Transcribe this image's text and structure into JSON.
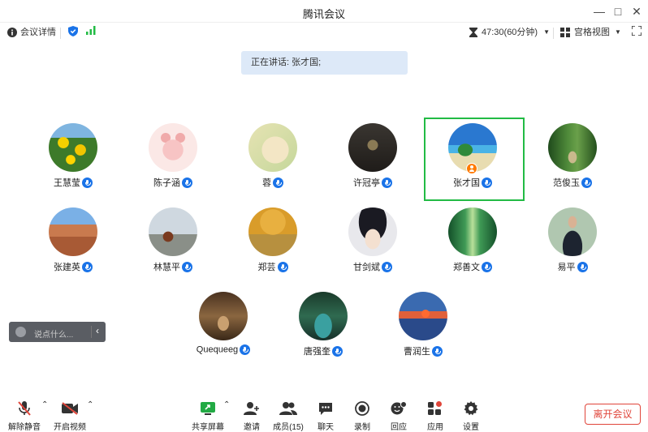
{
  "window": {
    "title": "腾讯会议"
  },
  "infobar": {
    "meeting_details": "会议详情",
    "timer": "47:30(60分钟)",
    "view_mode": "宫格视图"
  },
  "speaking": {
    "text": "正在讲话: 张才国;"
  },
  "participants": [
    {
      "name": "王慧莹"
    },
    {
      "name": "陈子涵"
    },
    {
      "name": "蓉"
    },
    {
      "name": "许冠亭"
    },
    {
      "name": "张才国"
    },
    {
      "name": "范俊玉"
    },
    {
      "name": "张建英"
    },
    {
      "name": "林慧平"
    },
    {
      "name": "郑芸"
    },
    {
      "name": "甘剑斌"
    },
    {
      "name": "郑善文"
    },
    {
      "name": "易平"
    },
    {
      "name": "Quequeeg"
    },
    {
      "name": "唐强奎"
    },
    {
      "name": "曹润生"
    }
  ],
  "chat": {
    "placeholder": "说点什么..."
  },
  "toolbar": {
    "unmute": "解除静音",
    "start_video": "开启视频",
    "share_screen": "共享屏幕",
    "invite": "邀请",
    "members": "成员(15)",
    "chat": "聊天",
    "record": "录制",
    "react": "回应",
    "apps": "应用",
    "settings": "设置",
    "leave": "离开会议"
  },
  "colors": {
    "accent": "#1a73e8",
    "active_speaker_border": "#22bb44",
    "leave": "#e0453a",
    "host_badge": "#ff7a00"
  }
}
